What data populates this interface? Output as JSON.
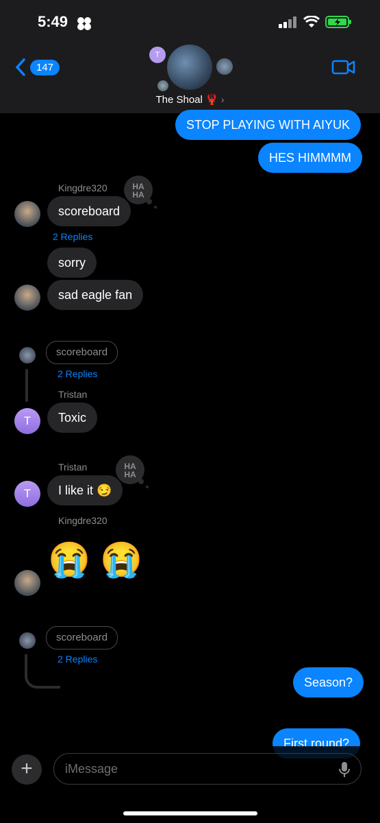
{
  "status_bar": {
    "time": "5:49"
  },
  "header": {
    "back_count": "147",
    "group_name": "The Shoal 🦞",
    "avatar_initial": "T"
  },
  "messages": {
    "out1": "STOP PLAYING WITH AIYUK",
    "out2": "HES HIMMMM",
    "sender_kingdre_1": "Kingdre320",
    "in_scoreboard": "scoreboard",
    "replies_1": "2 Replies",
    "in_sorry": "sorry",
    "in_sad": "sad eagle fan",
    "quote_1": "scoreboard",
    "replies_2": "2 Replies",
    "sender_tristan_1": "Tristan",
    "in_toxic": "Toxic",
    "sender_tristan_2": "Tristan",
    "in_like": "I like it 😏",
    "sender_kingdre_2": "Kingdre320",
    "emoji": "😭 😭",
    "quote_2": "scoreboard",
    "replies_3": "2 Replies",
    "out_season": "Season?",
    "out_first_round": "First round?",
    "tapback_text_top": "HA",
    "tapback_text_bottom": "HA",
    "tristan_initial": "T"
  },
  "composer": {
    "placeholder": "iMessage",
    "plus": "+"
  }
}
